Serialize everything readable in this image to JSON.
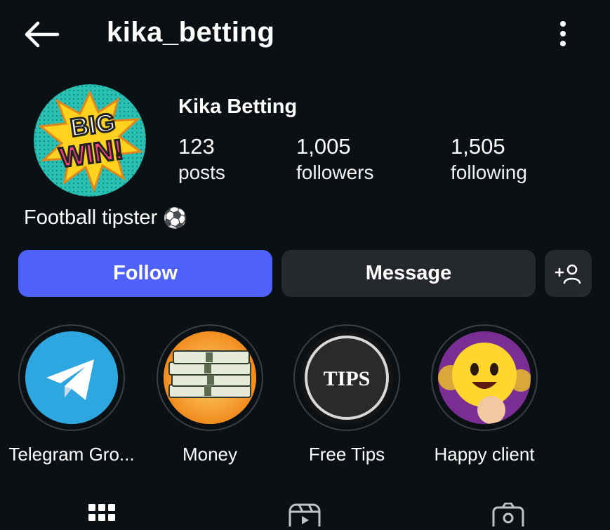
{
  "header": {
    "username": "kika_betting",
    "back_icon": "arrow-left-icon",
    "more_icon": "more-vertical-icon"
  },
  "profile": {
    "display_name": "Kika Betting",
    "avatar_icon": "big-win-comic-icon",
    "avatar_text": "BIG WIN!",
    "stats": {
      "posts": {
        "value": "123",
        "label": "posts"
      },
      "followers": {
        "value": "1,005",
        "label": "followers"
      },
      "following": {
        "value": "1,505",
        "label": "following"
      }
    },
    "bio": "Football tipster",
    "bio_emoji": "⚽"
  },
  "actions": {
    "follow_label": "Follow",
    "message_label": "Message",
    "add_user_icon": "add-user-icon",
    "accent": "#4f61fb",
    "secondary_bg": "#25292e"
  },
  "highlights": [
    {
      "label": "Telegram Gro...",
      "icon": "telegram-icon"
    },
    {
      "label": "Money",
      "icon": "money-stack-icon"
    },
    {
      "label": "Free Tips",
      "icon": "tips-badge-icon",
      "badge_text": "TIPS"
    },
    {
      "label": "Happy client",
      "icon": "smiley-coin-icon"
    }
  ],
  "tabs": [
    {
      "icon": "grid-icon"
    },
    {
      "icon": "reels-icon"
    },
    {
      "icon": "tagged-icon"
    }
  ]
}
